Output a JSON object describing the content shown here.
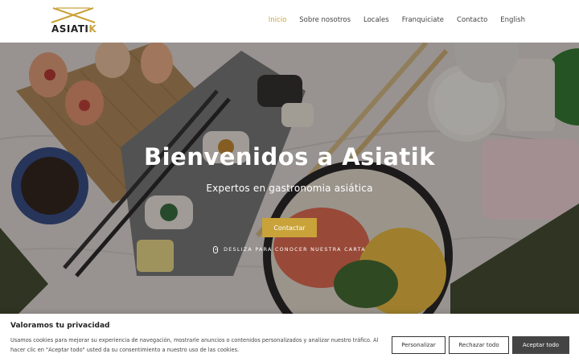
{
  "header": {
    "logo": {
      "name": "ASIATI",
      "accent_letter": "K"
    },
    "nav": [
      "Inicio",
      "Sobre nosotros",
      "Locales",
      "Franquiciate",
      "Contacto",
      "English"
    ],
    "active_nav": "Inicio"
  },
  "hero": {
    "title": "Bienvenidos a Asiatik",
    "subtitle": "Expertos en gastronomia asiática",
    "cta_label": "Contactar",
    "scroll_hint": "Desliza para conocer nuestra carta"
  },
  "cookie": {
    "title": "Valoramos tu privacidad",
    "text": "Usamos cookies para mejorar su experiencia de navegación, mostrarle anuncios o contenidos personalizados y analizar nuestro tráfico. Al hacer clic en \"Aceptar todo\" usted da su consentimiento a nuestro uso de las cookies.",
    "customize_label": "Personalizar",
    "reject_label": "Rechazar todo",
    "accept_label": "Aceptar todo"
  },
  "colors": {
    "accent": "#c9a23a",
    "dark": "#444444"
  }
}
